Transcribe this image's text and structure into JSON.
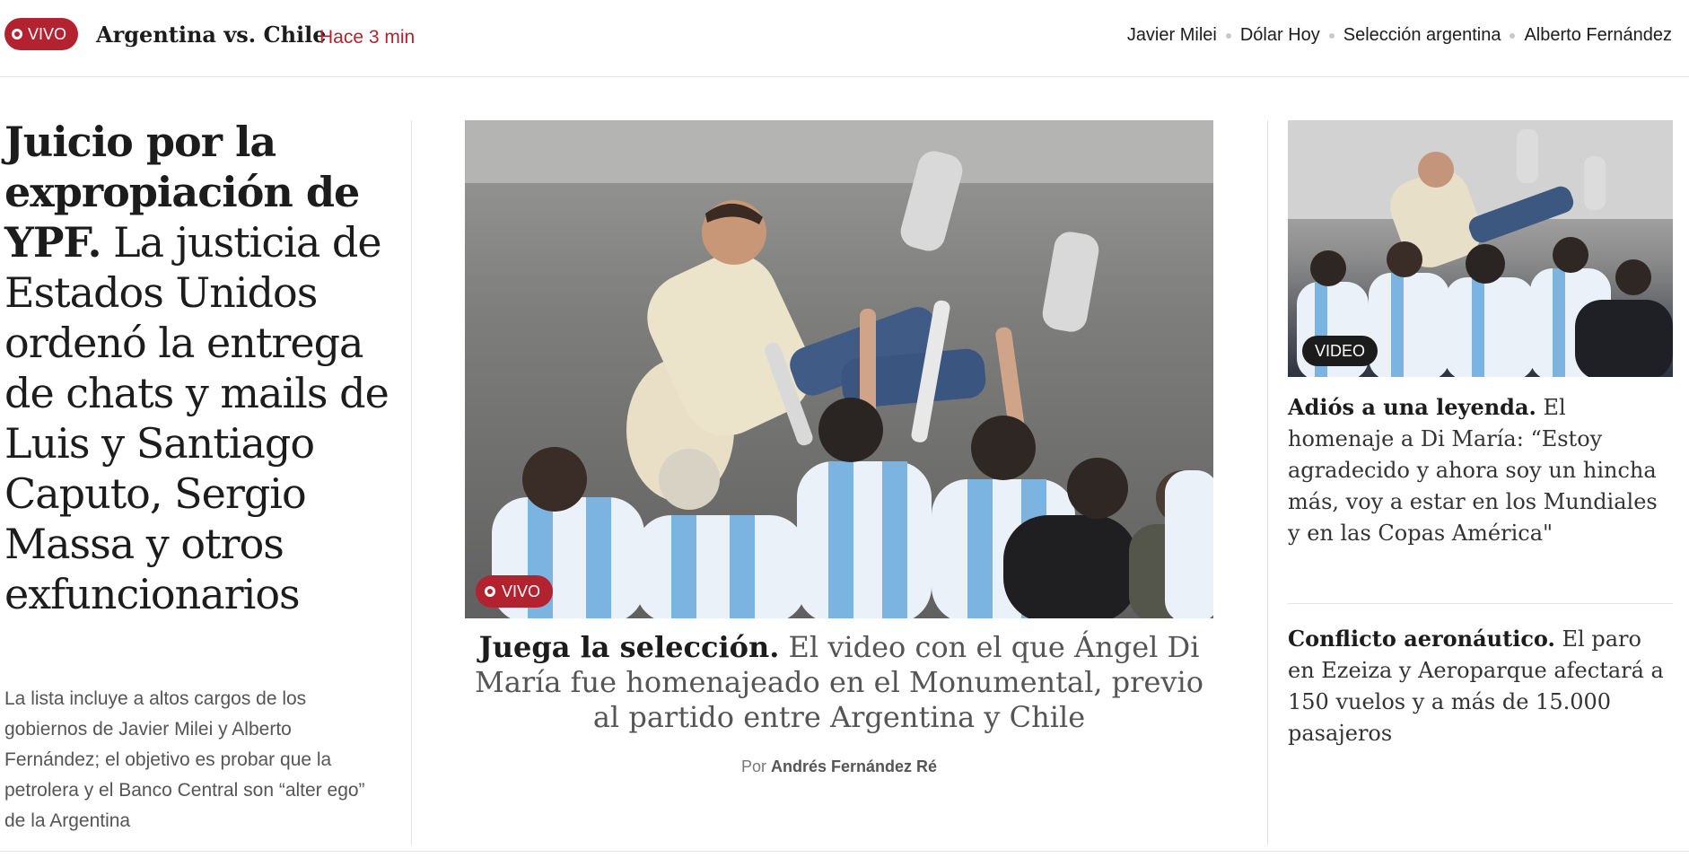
{
  "topbar": {
    "live_label": "VIVO",
    "live_title": "Argentina vs. Chile",
    "live_time": "Hace 3 min",
    "topics": [
      "Javier Milei",
      "Dólar Hoy",
      "Selección argentina",
      "Alberto Fernández"
    ]
  },
  "lead": {
    "kicker": "Juicio por la expropiación de YPF.",
    "headline": "La justicia de Estados Unidos ordenó la entrega de chats y mails de Luis y Santiago Caputo, Sergio Massa y otros exfuncionarios",
    "summary": "La lista incluye a altos cargos de los gobiernos de Javier Milei y Alberto Fernández; el objetivo es probar que la petrolera y el Banco Central son “alter ego” de la Argentina"
  },
  "main": {
    "photo_badge": "VIVO",
    "kicker": "Juega la selección.",
    "headline": "El video con el que Ángel Di María fue homenajeado en el Monumental, previo al partido entre Argentina y Chile",
    "byline_prefix": "Por",
    "author": "Andrés Fernández Ré"
  },
  "side": [
    {
      "badge": "VIDEO",
      "kicker": "Adiós a una leyenda.",
      "headline": "El homenaje a Di María: “Estoy agradecido y ahora soy un hincha más, voy a estar en los Mundiales y en las Copas América\""
    },
    {
      "kicker": "Conflicto aeronáutico.",
      "headline": "El paro en Ezeiza y Aeroparque afectará a 150 vuelos y a más de 15.000 pasajeros"
    }
  ],
  "colors": {
    "accent": "#b3232f",
    "text": "#1c1c1c",
    "muted": "#555555"
  }
}
